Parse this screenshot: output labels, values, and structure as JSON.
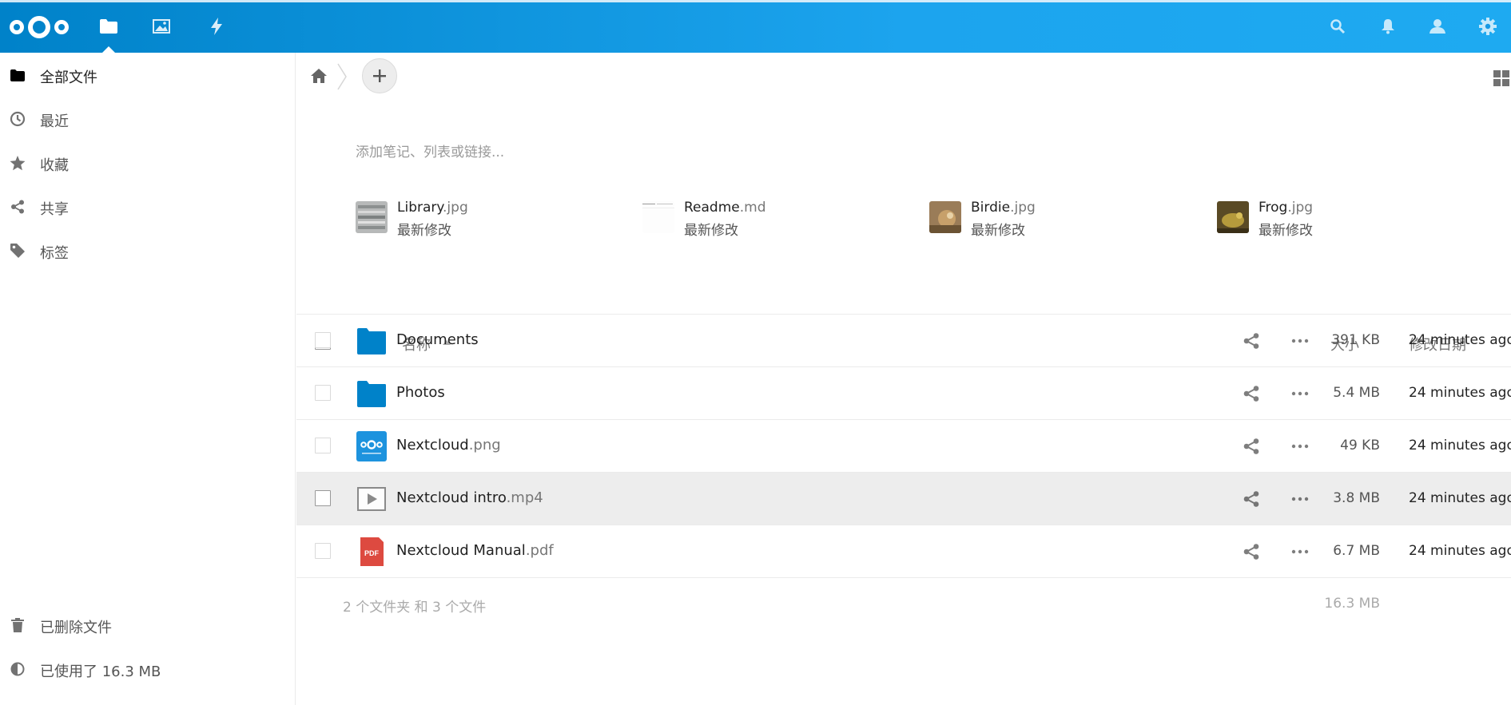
{
  "header": {
    "brand_color": "#0082c9",
    "apps": [
      {
        "name": "files",
        "icon": "folder-icon",
        "active": true
      },
      {
        "name": "photos",
        "icon": "image-icon",
        "active": false
      },
      {
        "name": "activity",
        "icon": "lightning-icon",
        "active": false
      }
    ],
    "right_icons": [
      "search-icon",
      "bell-icon",
      "contacts-icon",
      "gear-icon"
    ]
  },
  "sidebar": {
    "items": [
      {
        "label": "全部文件",
        "icon": "folder-icon"
      },
      {
        "label": "最近",
        "icon": "clock-icon"
      },
      {
        "label": "收藏",
        "icon": "star-icon"
      },
      {
        "label": "共享",
        "icon": "share-icon"
      },
      {
        "label": "标签",
        "icon": "tag-icon"
      }
    ],
    "trash_label": "已删除文件",
    "quota_label": "已使用了 16.3 MB"
  },
  "main": {
    "note_placeholder": "添加笔记、列表或链接...",
    "recent": [
      {
        "base": "Library",
        "ext": ".jpg",
        "sub": "最新修改"
      },
      {
        "base": "Readme",
        "ext": ".md",
        "sub": "最新修改"
      },
      {
        "base": "Birdie",
        "ext": ".jpg",
        "sub": "最新修改"
      },
      {
        "base": "Frog",
        "ext": ".jpg",
        "sub": "最新修改"
      }
    ],
    "columns": {
      "name": "名称",
      "size": "大小",
      "date": "修改日期"
    },
    "files": [
      {
        "base": "Documents",
        "ext": "",
        "type": "folder",
        "size": "391 KB",
        "date": "24 minutes ago"
      },
      {
        "base": "Photos",
        "ext": "",
        "type": "folder",
        "size": "5.4 MB",
        "date": "24 minutes ago"
      },
      {
        "base": "Nextcloud",
        "ext": ".png",
        "type": "image",
        "size": "49 KB",
        "date": "24 minutes ago"
      },
      {
        "base": "Nextcloud intro",
        "ext": ".mp4",
        "type": "video",
        "size": "3.8 MB",
        "date": "24 minutes ago"
      },
      {
        "base": "Nextcloud Manual",
        "ext": ".pdf",
        "type": "pdf",
        "size": "6.7 MB",
        "date": "24 minutes ago"
      }
    ],
    "summary": {
      "count": "2 个文件夹 和 3 个文件",
      "total": "16.3 MB"
    }
  }
}
